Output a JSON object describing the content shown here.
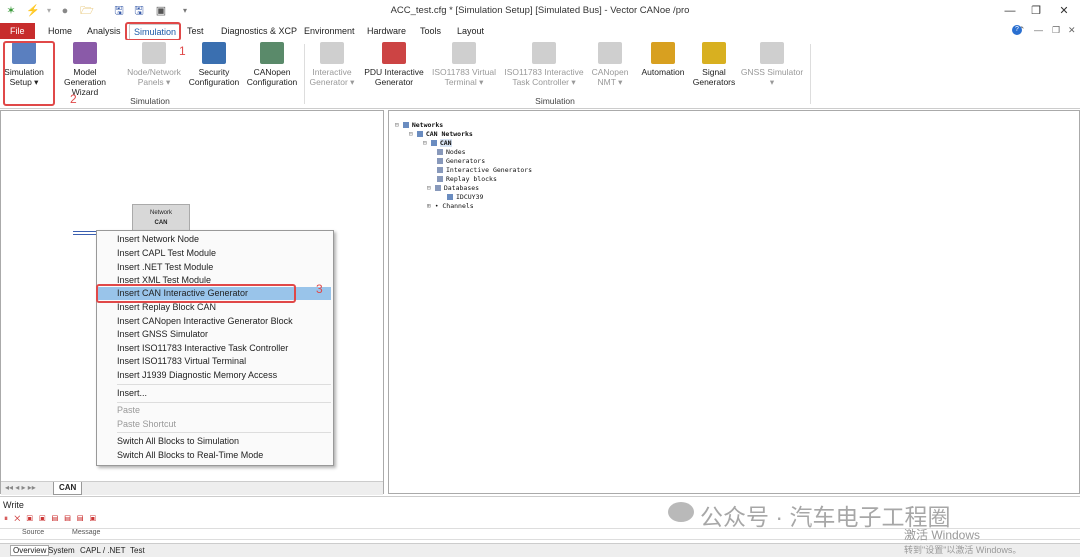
{
  "window": {
    "title": "ACC_test.cfg * [Simulation Setup] [Simulated Bus] - Vector CANoe /pro"
  },
  "menu_tabs": [
    "File",
    "Home",
    "Analysis",
    "Simulation",
    "Test",
    "Diagnostics & XCP",
    "Environment",
    "Hardware",
    "Tools",
    "Layout"
  ],
  "ribbon": {
    "simulation_group": {
      "label": "Simulation",
      "buttons": [
        {
          "label1": "Simulation",
          "label2": "Setup ▾",
          "icon": "simulation-setup-icon",
          "enabled": true
        },
        {
          "label1": "Model Generation",
          "label2": "Wizard",
          "icon": "wizard-icon",
          "enabled": true
        },
        {
          "label1": "Node/Network",
          "label2": "Panels ▾",
          "icon": "panels-icon",
          "enabled": false
        },
        {
          "label1": "Security",
          "label2": "Configuration",
          "icon": "security-icon",
          "enabled": true
        },
        {
          "label1": "CANopen",
          "label2": "Configuration",
          "icon": "canopen-icon",
          "enabled": true
        }
      ]
    },
    "simulation_group2": {
      "label": "Simulation",
      "buttons": [
        {
          "label1": "Interactive",
          "label2": "Generator ▾",
          "icon": "ig-icon",
          "enabled": false
        },
        {
          "label1": "PDU Interactive",
          "label2": "Generator",
          "icon": "pdu-ig-icon",
          "enabled": true
        },
        {
          "label1": "ISO11783 Virtual",
          "label2": "Terminal ▾",
          "icon": "vt-icon",
          "enabled": false
        },
        {
          "label1": "ISO11783 Interactive",
          "label2": "Task Controller ▾",
          "icon": "tc-icon",
          "enabled": false
        },
        {
          "label1": "CANopen",
          "label2": "NMT ▾",
          "icon": "nmt-icon",
          "enabled": false
        },
        {
          "label1": "Automation",
          "label2": "",
          "icon": "automation-icon",
          "enabled": true
        },
        {
          "label1": "Signal",
          "label2": "Generators",
          "icon": "signal-gen-icon",
          "enabled": true
        },
        {
          "label1": "GNSS Simulator",
          "label2": "▾",
          "icon": "gnss-icon",
          "enabled": false
        }
      ]
    }
  },
  "annotations": {
    "a1": "1",
    "a2": "2",
    "a3": "3"
  },
  "network_block": {
    "line1": "Network",
    "line2": "CAN"
  },
  "context_menu": [
    {
      "label": "Insert Network Node",
      "enabled": true
    },
    {
      "label": "Insert CAPL Test Module",
      "enabled": true
    },
    {
      "label": "Insert .NET Test Module",
      "enabled": true
    },
    {
      "label": "Insert XML Test Module",
      "enabled": true
    },
    {
      "label": "Insert CAN Interactive Generator",
      "enabled": true,
      "highlighted": true
    },
    {
      "label": "Insert Replay Block CAN",
      "enabled": true
    },
    {
      "label": "Insert CANopen Interactive Generator Block",
      "enabled": true
    },
    {
      "label": "Insert GNSS Simulator",
      "enabled": true
    },
    {
      "label": "Insert ISO11783 Interactive Task Controller",
      "enabled": true
    },
    {
      "label": "Insert ISO11783 Virtual Terminal",
      "enabled": true
    },
    {
      "label": "Insert J1939 Diagnostic Memory Access",
      "enabled": true
    },
    {
      "label": "Insert...",
      "enabled": true
    },
    {
      "label": "Paste",
      "enabled": false
    },
    {
      "label": "Paste Shortcut",
      "enabled": false
    },
    {
      "label": "Switch All Blocks to Simulation",
      "enabled": true
    },
    {
      "label": "Switch All Blocks to Real-Time Mode",
      "enabled": true
    }
  ],
  "left_tab": "CAN",
  "tree": [
    {
      "label": "Networks",
      "bold": true
    },
    {
      "label": "CAN Networks",
      "bold": true
    },
    {
      "label": "CAN",
      "bold": true
    },
    {
      "label": "Nodes",
      "bold": false
    },
    {
      "label": "Generators",
      "bold": false
    },
    {
      "label": "Interactive Generators",
      "bold": false
    },
    {
      "label": "Replay blocks",
      "bold": false
    },
    {
      "label": "Databases",
      "bold": false
    },
    {
      "label": "IDCUY39",
      "bold": false
    },
    {
      "label": "Channels",
      "bold": false
    }
  ],
  "write": {
    "title": "Write",
    "col_source": "Source",
    "col_message": "Message",
    "tabs": [
      "Overview",
      "System",
      "CAPL / .NET",
      "Test"
    ]
  },
  "watermark": {
    "brand": "公众号 · 汽车电子工程圈",
    "activate1": "激活 Windows",
    "activate2": "转到\"设置\"以激活 Windows。"
  }
}
